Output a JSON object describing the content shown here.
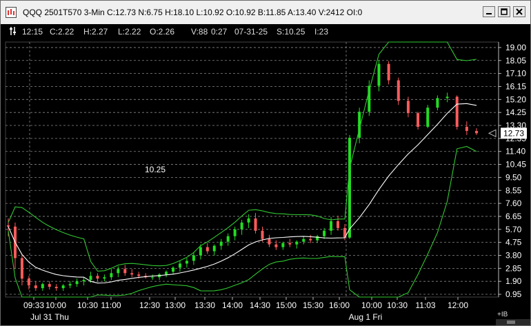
{
  "window": {
    "title": "QQQ 2501T570 3-Min C:12.73 N:6.75 H:18.10 L:10.92 O:10.92 B:11.85 A:13.40 V:2412 OI:0",
    "app_icon": "chart-app-icon",
    "buttons": [
      {
        "name": "minimize-button",
        "icon": "minimize-icon"
      },
      {
        "name": "maximize-button",
        "icon": "maximize-icon"
      },
      {
        "name": "close-button",
        "icon": "close-icon"
      }
    ]
  },
  "infobar": {
    "settings_icon": "settings-icon",
    "time": "12:15",
    "close": "C:2.22",
    "high": "H:2.27",
    "low": "L:2.22",
    "open": "O:2.26",
    "volume": "V:88",
    "elapsed": "0:27",
    "date": "07-31-25",
    "strike": "S:10.25",
    "index": "I:23"
  },
  "colors": {
    "up": "#22dd22",
    "down": "#ff5b5b",
    "band": "#32c832",
    "average": "#ffffff",
    "grid": "#8a8a8a",
    "axis_text": "#ffffff",
    "price_marker_bg": "#ffffff"
  },
  "chart_data": {
    "type": "candlestick",
    "y_ticks": [
      "19.00",
      "18.05",
      "17.10",
      "16.15",
      "15.20",
      "14.25",
      "13.30",
      "12.35",
      "11.40",
      "10.45",
      "9.50",
      "8.55",
      "7.60",
      "6.65",
      "5.70",
      "4.75",
      "3.80",
      "2.85",
      "1.90",
      "0.95"
    ],
    "ylim": [
      0.75,
      19.4
    ],
    "x_ticks": [
      "09:33",
      "10:00",
      "10:30",
      "11:00",
      "12:30",
      "13:00",
      "13:30",
      "14:00",
      "14:30",
      "15:00",
      "15:30",
      "16:00",
      "10:00",
      "10:30",
      "11:03",
      "12:00"
    ],
    "date_labels": [
      "Jul 31 Thu",
      "Aug 1 Fri"
    ],
    "last_price": "12.73",
    "crosshair_price": "10.25",
    "corner_label": "+IB",
    "candles": [
      [
        6.0,
        6.5,
        5.2,
        5.9
      ],
      [
        5.9,
        6.2,
        2.8,
        3.6
      ],
      [
        3.6,
        3.9,
        1.6,
        2.1
      ],
      [
        2.1,
        2.3,
        1.3,
        1.6
      ],
      [
        1.6,
        1.9,
        1.2,
        1.4
      ],
      [
        1.4,
        1.8,
        1.2,
        1.7
      ],
      [
        1.7,
        1.9,
        1.3,
        1.5
      ],
      [
        1.5,
        1.7,
        1.2,
        1.4
      ],
      [
        1.4,
        1.7,
        1.2,
        1.6
      ],
      [
        1.6,
        1.9,
        1.4,
        1.7
      ],
      [
        1.7,
        2.1,
        1.5,
        1.9
      ],
      [
        1.9,
        2.2,
        1.6,
        2.0
      ],
      [
        2.0,
        2.6,
        1.8,
        2.3
      ],
      [
        2.3,
        2.5,
        1.9,
        2.1
      ],
      [
        2.1,
        2.4,
        1.9,
        2.2
      ],
      [
        2.2,
        2.8,
        2.0,
        2.5
      ],
      [
        2.5,
        3.0,
        2.2,
        2.8
      ],
      [
        2.8,
        3.1,
        2.3,
        2.5
      ],
      [
        2.5,
        2.8,
        2.2,
        2.4
      ],
      [
        2.4,
        2.6,
        2.1,
        2.3
      ],
      [
        2.3,
        2.5,
        2.1,
        2.2
      ],
      [
        2.2,
        2.4,
        2.0,
        2.2
      ],
      [
        2.2,
        2.5,
        2.0,
        2.4
      ],
      [
        2.4,
        2.7,
        2.2,
        2.6
      ],
      [
        2.6,
        3.0,
        2.4,
        2.9
      ],
      [
        2.9,
        3.4,
        2.6,
        3.2
      ],
      [
        3.2,
        3.6,
        2.9,
        3.4
      ],
      [
        3.4,
        4.0,
        3.1,
        3.8
      ],
      [
        3.8,
        4.6,
        3.5,
        4.4
      ],
      [
        4.4,
        4.7,
        3.9,
        4.1
      ],
      [
        4.1,
        4.6,
        3.8,
        4.5
      ],
      [
        4.5,
        5.0,
        4.2,
        4.8
      ],
      [
        4.8,
        5.4,
        4.5,
        5.2
      ],
      [
        5.2,
        5.9,
        4.9,
        5.7
      ],
      [
        5.7,
        6.4,
        5.3,
        6.2
      ],
      [
        6.2,
        6.8,
        5.8,
        6.5
      ],
      [
        6.5,
        6.9,
        5.4,
        5.6
      ],
      [
        5.6,
        5.9,
        4.8,
        5.0
      ],
      [
        5.0,
        5.3,
        4.4,
        4.6
      ],
      [
        4.6,
        4.9,
        4.2,
        4.4
      ],
      [
        4.4,
        4.8,
        4.2,
        4.7
      ],
      [
        4.7,
        5.0,
        4.4,
        4.6
      ],
      [
        4.6,
        4.9,
        4.3,
        4.8
      ],
      [
        4.8,
        5.2,
        4.6,
        5.0
      ],
      [
        5.0,
        5.3,
        4.7,
        4.9
      ],
      [
        4.9,
        5.3,
        4.7,
        5.2
      ],
      [
        5.2,
        5.8,
        5.0,
        5.6
      ],
      [
        5.6,
        6.6,
        5.3,
        6.3
      ],
      [
        6.3,
        6.7,
        5.6,
        5.8
      ],
      [
        5.8,
        6.1,
        4.9,
        5.1
      ],
      [
        5.1,
        12.6,
        5.0,
        12.4
      ],
      [
        12.4,
        14.6,
        12.0,
        14.3
      ],
      [
        14.3,
        16.6,
        14.0,
        16.2
      ],
      [
        16.2,
        18.1,
        15.8,
        17.8
      ],
      [
        17.8,
        18.0,
        16.3,
        16.6
      ],
      [
        16.6,
        16.8,
        14.8,
        15.1
      ],
      [
        15.1,
        15.4,
        13.9,
        14.2
      ],
      [
        14.2,
        14.3,
        13.0,
        13.2
      ],
      [
        13.2,
        14.8,
        13.1,
        14.6
      ],
      [
        14.6,
        15.5,
        14.4,
        15.3
      ],
      [
        15.3,
        15.7,
        15.0,
        15.4
      ],
      [
        15.4,
        15.5,
        13.0,
        13.2
      ],
      [
        13.2,
        13.6,
        12.6,
        12.9
      ],
      [
        12.9,
        13.1,
        12.6,
        12.73
      ]
    ]
  }
}
